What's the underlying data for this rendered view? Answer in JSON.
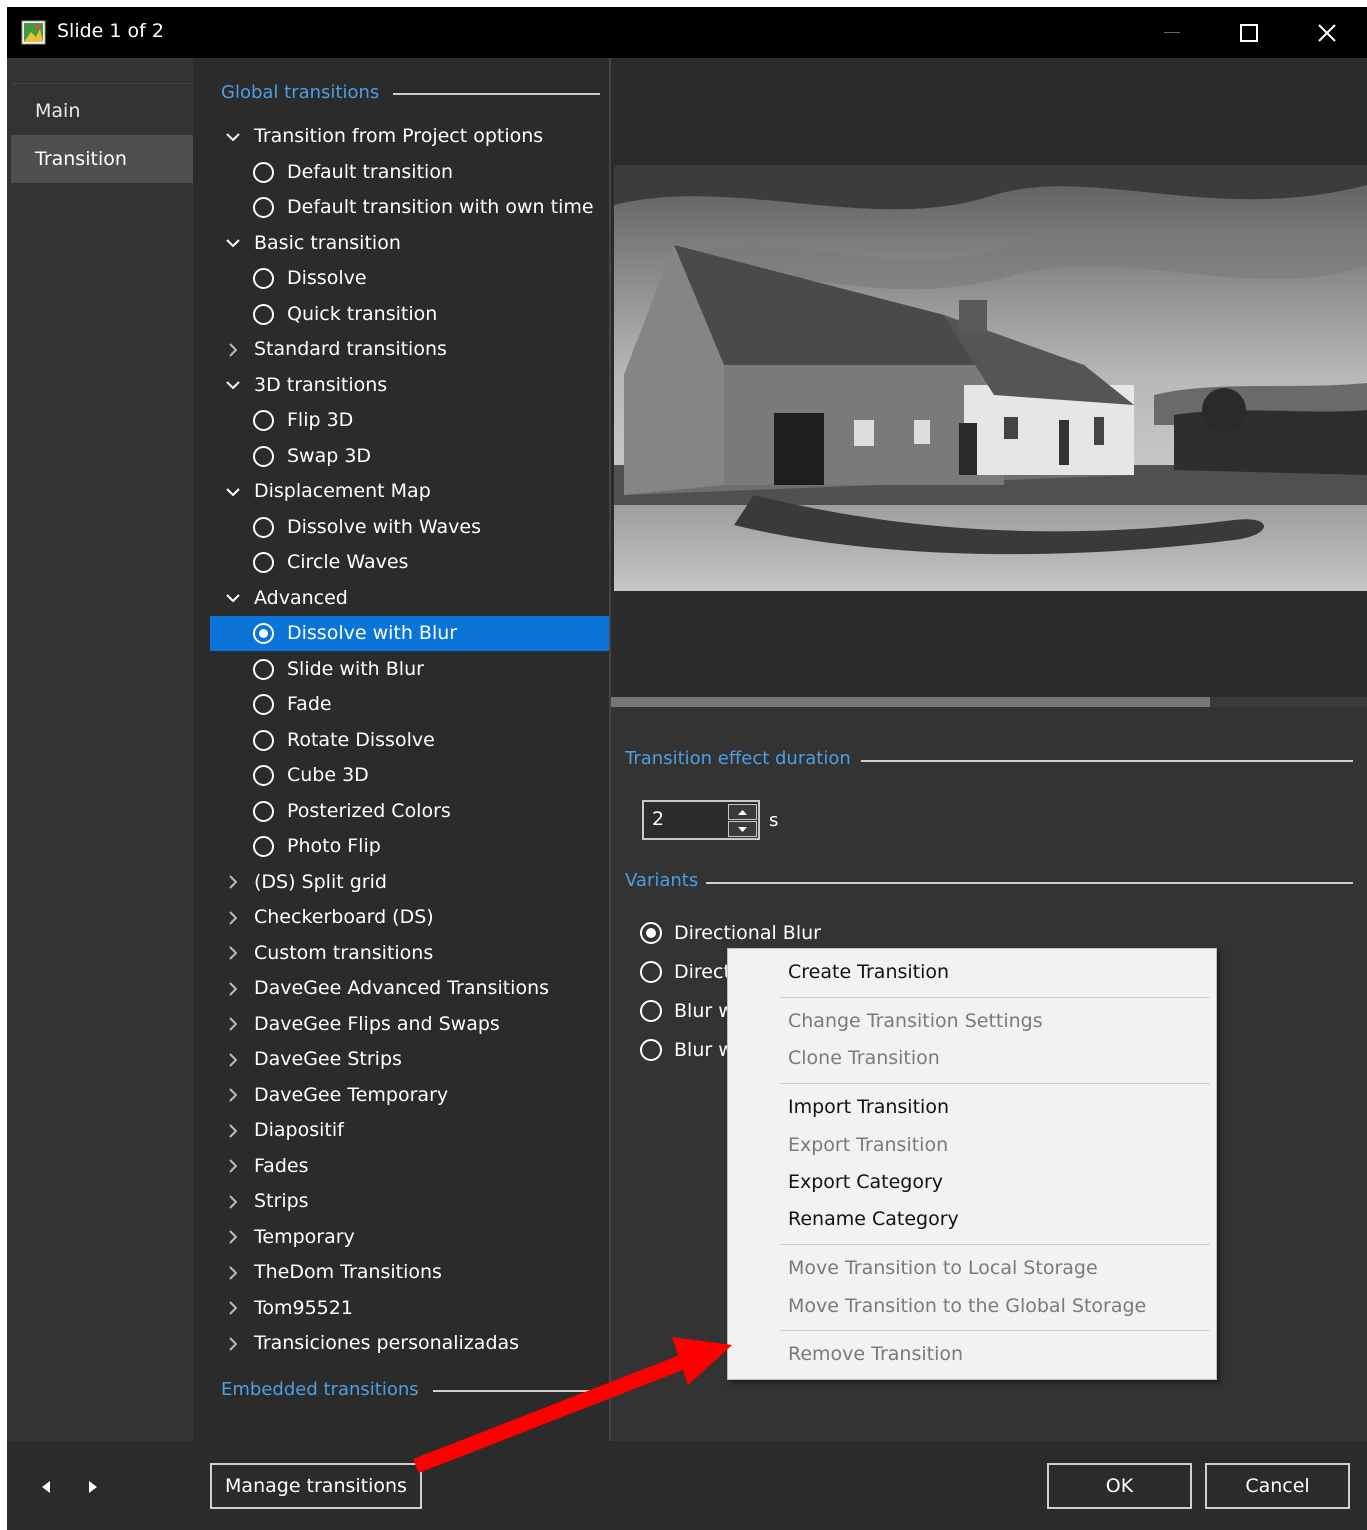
{
  "window": {
    "title": "Slide 1 of 2"
  },
  "nav": {
    "items": [
      {
        "label": "Main",
        "active": false
      },
      {
        "label": "Transition",
        "active": true
      }
    ]
  },
  "tree": {
    "global_heading": "Global transitions",
    "embedded_heading": "Embedded transitions",
    "rows": [
      {
        "type": "category",
        "label": "Transition from Project options",
        "expanded": true
      },
      {
        "type": "item",
        "label": "Default transition"
      },
      {
        "type": "item",
        "label": "Default transition with own time"
      },
      {
        "type": "category",
        "label": "Basic transition",
        "expanded": true
      },
      {
        "type": "item",
        "label": "Dissolve"
      },
      {
        "type": "item",
        "label": "Quick transition"
      },
      {
        "type": "category",
        "label": "Standard transitions",
        "expanded": false
      },
      {
        "type": "category",
        "label": "3D transitions",
        "expanded": true
      },
      {
        "type": "item",
        "label": "Flip 3D"
      },
      {
        "type": "item",
        "label": "Swap 3D"
      },
      {
        "type": "category",
        "label": "Displacement Map",
        "expanded": true
      },
      {
        "type": "item",
        "label": "Dissolve with Waves"
      },
      {
        "type": "item",
        "label": "Circle Waves"
      },
      {
        "type": "category",
        "label": "Advanced",
        "expanded": true
      },
      {
        "type": "item",
        "label": "Dissolve with Blur",
        "selected": true
      },
      {
        "type": "item",
        "label": "Slide with Blur"
      },
      {
        "type": "item",
        "label": "Fade"
      },
      {
        "type": "item",
        "label": "Rotate Dissolve"
      },
      {
        "type": "item",
        "label": "Cube 3D"
      },
      {
        "type": "item",
        "label": "Posterized Colors"
      },
      {
        "type": "item",
        "label": "Photo Flip"
      },
      {
        "type": "category",
        "label": "(DS) Split grid",
        "expanded": false
      },
      {
        "type": "category",
        "label": "Checkerboard (DS)",
        "expanded": false
      },
      {
        "type": "category",
        "label": "Custom transitions",
        "expanded": false
      },
      {
        "type": "category",
        "label": "DaveGee Advanced Transitions",
        "expanded": false
      },
      {
        "type": "category",
        "label": "DaveGee Flips and Swaps",
        "expanded": false
      },
      {
        "type": "category",
        "label": "DaveGee Strips",
        "expanded": false
      },
      {
        "type": "category",
        "label": "DaveGee Temporary",
        "expanded": false
      },
      {
        "type": "category",
        "label": "Diapositif",
        "expanded": false
      },
      {
        "type": "category",
        "label": "Fades",
        "expanded": false
      },
      {
        "type": "category",
        "label": "Strips",
        "expanded": false
      },
      {
        "type": "category",
        "label": "Temporary",
        "expanded": false
      },
      {
        "type": "category",
        "label": "TheDom Transitions",
        "expanded": false
      },
      {
        "type": "category",
        "label": "Tom95521",
        "expanded": false
      },
      {
        "type": "category",
        "label": "Transiciones personalizadas",
        "expanded": false
      }
    ]
  },
  "right": {
    "duration_heading": "Transition effect duration",
    "duration_value": "2",
    "duration_unit": "s",
    "variants_heading": "Variants",
    "variants": [
      {
        "label": "Directional Blur",
        "checked": true
      },
      {
        "label": "Direct",
        "checked": false
      },
      {
        "label": "Blur w",
        "checked": false
      },
      {
        "label": "Blur w",
        "checked": false
      }
    ]
  },
  "context_menu": {
    "create": "Create Transition",
    "change_settings": "Change Transition Settings",
    "clone": "Clone Transition",
    "import": "Import Transition",
    "export": "Export Transition",
    "export_category": "Export Category",
    "rename_category": "Rename Category",
    "move_local": "Move Transition to Local Storage",
    "move_global": "Move Transition to the Global Storage",
    "remove": "Remove Transition"
  },
  "bottom": {
    "manage_label": "Manage transitions",
    "ok_label": "OK",
    "cancel_label": "Cancel"
  },
  "colors": {
    "accent": "#0a74d8",
    "heading_blue": "#4d9fe3",
    "annotation_arrow": "#ff0000"
  }
}
